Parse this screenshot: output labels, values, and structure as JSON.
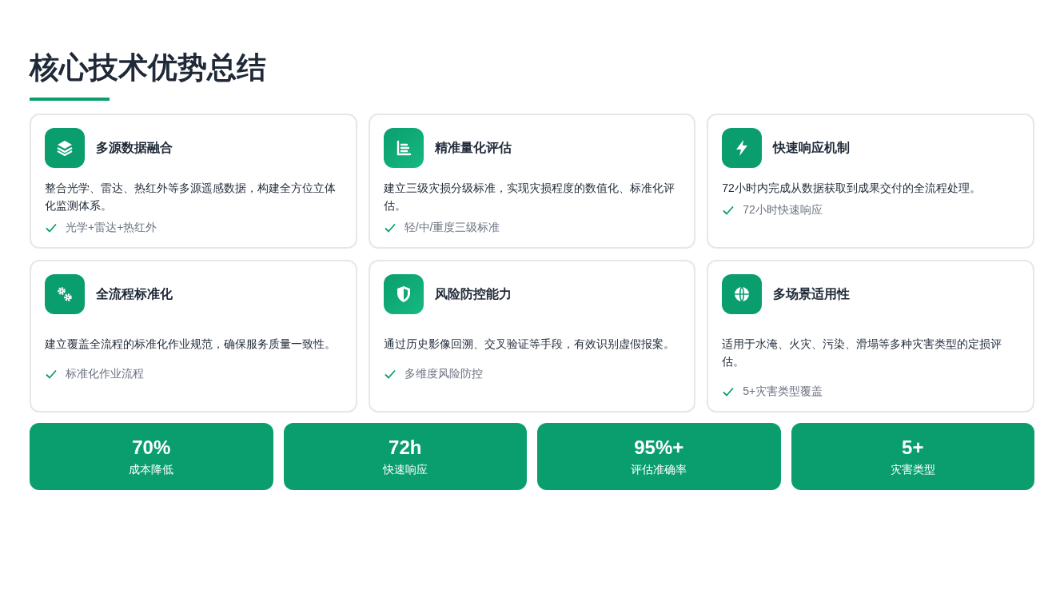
{
  "title": "核心技术优势总结",
  "features": [
    {
      "title": "多源数据融合",
      "description": "整合光学、雷达、热红外等多源遥感数据，构建全方位立体化监测体系。",
      "point": "光学+雷达+热红外"
    },
    {
      "title": "精准量化评估",
      "description": "建立三级灾损分级标准，实现灾损程度的数值化、标准化评估。",
      "point": "轻/中/重度三级标准"
    },
    {
      "title": "快速响应机制",
      "description": "72小时内完成从数据获取到成果交付的全流程处理。",
      "point": "72小时快速响应"
    },
    {
      "title": "全流程标准化",
      "description": "建立覆盖全流程的标准化作业规范，确保服务质量一致性。",
      "point": "标准化作业流程"
    },
    {
      "title": "风险防控能力",
      "description": "通过历史影像回溯、交叉验证等手段，有效识别虚假报案。",
      "point": "多维度风险防控"
    },
    {
      "title": "多场景适用性",
      "description": "适用于水淹、火灾、污染、滑塌等多种灾害类型的定损评估。",
      "point": "5+灾害类型覆盖"
    }
  ],
  "stats": [
    {
      "value": "70%",
      "label": "成本降低"
    },
    {
      "value": "72h",
      "label": "快速响应"
    },
    {
      "value": "95%+",
      "label": "评估准确率"
    },
    {
      "value": "5+",
      "label": "灾害类型"
    }
  ]
}
